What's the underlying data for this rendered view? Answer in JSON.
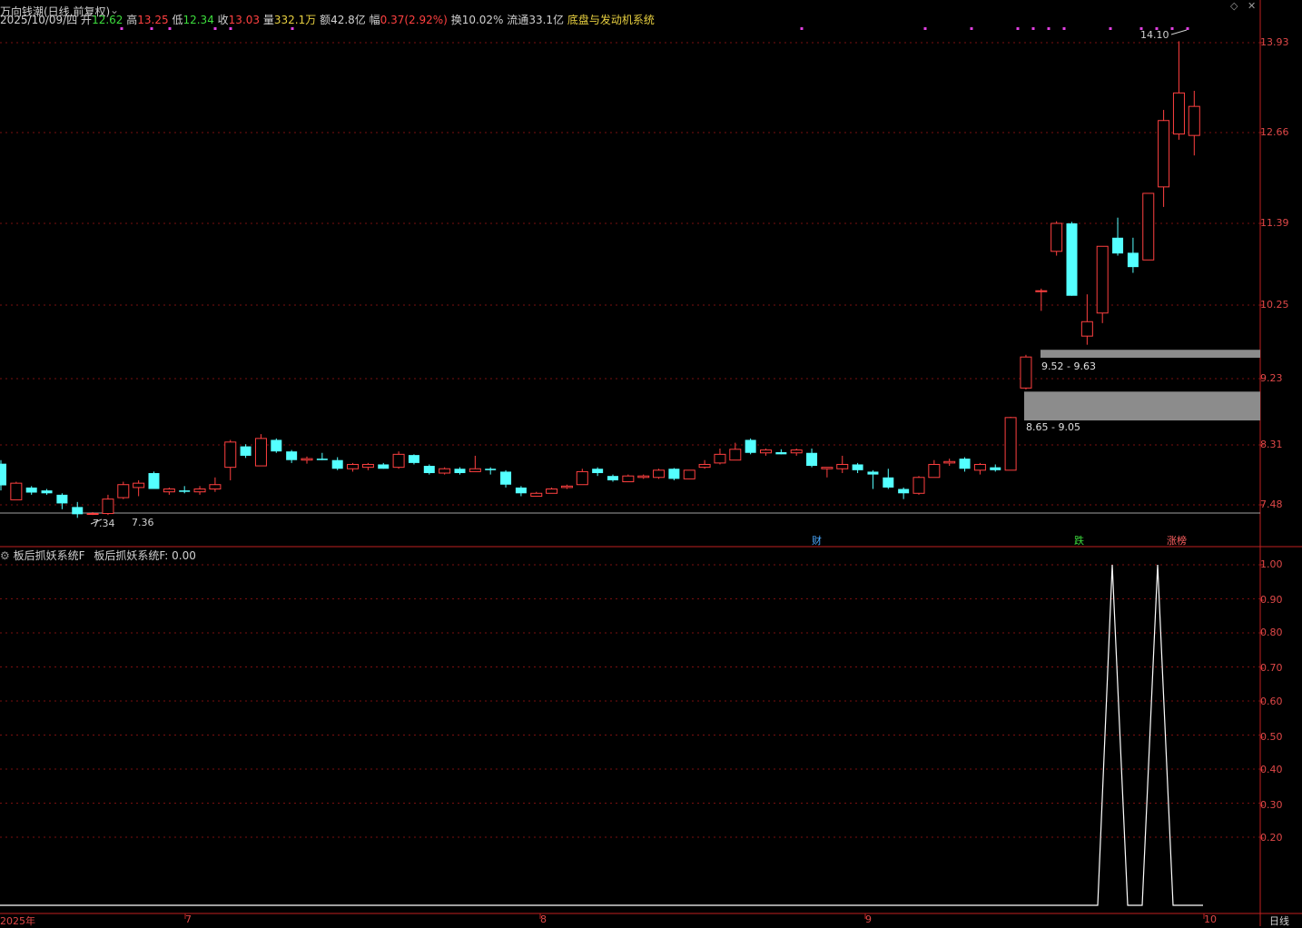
{
  "header": {
    "app_title": "万向钱潮(日线,前复权)",
    "date": "2025/10/09/四",
    "open_label": "开",
    "open": "12.62",
    "high_label": "高",
    "high": "13.25",
    "low_label": "低",
    "low": "12.34",
    "close_label": "收",
    "close": "13.03",
    "volume_label": "量",
    "volume": "332.1万",
    "amount_label": "额",
    "amount": "42.8亿",
    "change_label": "幅",
    "change": "0.37(2.92%)",
    "turnover_label": "换",
    "turnover": "10.02%",
    "float_label": "流通",
    "float": "33.1亿",
    "system_name": "底盘与发动机系统"
  },
  "price_axis": [
    "13.93",
    "12.66",
    "11.39",
    "10.25",
    "9.23",
    "8.31",
    "7.48"
  ],
  "indicator_axis": [
    "1.00",
    "0.90",
    "0.80",
    "0.70",
    "0.60",
    "0.50",
    "0.40",
    "0.30",
    "0.20"
  ],
  "x_axis": [
    "2025年",
    "7",
    "8",
    "9",
    "10"
  ],
  "period_label": "日线",
  "annotations": {
    "high_marker": "14.10",
    "low_marker_left": "7.34",
    "low_marker_right": "7.36",
    "gap_upper": "9.52 - 9.63",
    "gap_lower": "8.65 - 9.05"
  },
  "event_marks": [
    {
      "label": "财",
      "color": "#4aa8ff"
    },
    {
      "label": "跌",
      "color": "#3cdc3c"
    },
    {
      "label": "涨榜",
      "color": "#ff6060"
    }
  ],
  "indicator": {
    "name": "板后抓妖系统F",
    "value_text": "板后抓妖系统F: 0.00"
  },
  "colors": {
    "up": "#ff4040",
    "down": "#54ffff",
    "grid": "#7a1010",
    "axis": "#c02020"
  },
  "chart_data": [
    {
      "type": "candlestick",
      "title": "",
      "ylim": [
        7.2,
        14.2
      ],
      "series": [
        {
          "name": "",
          "ohlc": [
            [
              8.05,
              8.1,
              7.68,
              7.75
            ],
            [
              7.55,
              7.8,
              7.55,
              7.78
            ],
            [
              7.72,
              7.74,
              7.62,
              7.65
            ],
            [
              7.68,
              7.7,
              7.62,
              7.64
            ],
            [
              7.62,
              7.64,
              7.42,
              7.5
            ],
            [
              7.45,
              7.52,
              7.3,
              7.35
            ],
            [
              7.36,
              7.38,
              7.34,
              7.36
            ],
            [
              7.36,
              7.62,
              7.34,
              7.56
            ],
            [
              7.58,
              7.8,
              7.56,
              7.76
            ],
            [
              7.72,
              7.82,
              7.6,
              7.78
            ],
            [
              7.92,
              7.94,
              7.7,
              7.7
            ],
            [
              7.66,
              7.72,
              7.62,
              7.7
            ],
            [
              7.68,
              7.74,
              7.64,
              7.66
            ],
            [
              7.66,
              7.74,
              7.62,
              7.7
            ],
            [
              7.7,
              7.86,
              7.66,
              7.76
            ],
            [
              8.0,
              8.38,
              7.82,
              8.35
            ],
            [
              8.29,
              8.32,
              8.13,
              8.16
            ],
            [
              8.02,
              8.46,
              8.02,
              8.4
            ],
            [
              8.38,
              8.4,
              8.2,
              8.22
            ],
            [
              8.22,
              8.24,
              8.06,
              8.1
            ],
            [
              8.1,
              8.15,
              8.05,
              8.12
            ],
            [
              8.12,
              8.2,
              8.1,
              8.1
            ],
            [
              8.1,
              8.14,
              7.96,
              7.98
            ],
            [
              7.98,
              8.06,
              7.94,
              8.04
            ],
            [
              8.0,
              8.06,
              7.96,
              8.04
            ],
            [
              8.04,
              8.06,
              7.98,
              7.98
            ],
            [
              8.0,
              8.22,
              7.98,
              8.18
            ],
            [
              8.17,
              8.18,
              8.04,
              8.06
            ],
            [
              8.02,
              8.04,
              7.9,
              7.92
            ],
            [
              7.92,
              8.0,
              7.9,
              7.98
            ],
            [
              7.98,
              8.0,
              7.9,
              7.92
            ],
            [
              7.94,
              8.16,
              7.94,
              7.98
            ],
            [
              7.98,
              8.0,
              7.9,
              7.96
            ],
            [
              7.94,
              7.96,
              7.72,
              7.76
            ],
            [
              7.72,
              7.74,
              7.6,
              7.64
            ],
            [
              7.6,
              7.66,
              7.6,
              7.64
            ],
            [
              7.64,
              7.72,
              7.64,
              7.7
            ],
            [
              7.72,
              7.76,
              7.7,
              7.74
            ],
            [
              7.76,
              7.98,
              7.76,
              7.94
            ],
            [
              7.98,
              8.0,
              7.88,
              7.92
            ],
            [
              7.88,
              7.9,
              7.8,
              7.82
            ],
            [
              7.8,
              7.9,
              7.8,
              7.88
            ],
            [
              7.86,
              7.9,
              7.84,
              7.88
            ],
            [
              7.86,
              7.98,
              7.84,
              7.96
            ],
            [
              7.98,
              7.99,
              7.82,
              7.84
            ],
            [
              7.84,
              7.96,
              7.84,
              7.96
            ],
            [
              8.0,
              8.1,
              7.98,
              8.04
            ],
            [
              8.06,
              8.26,
              8.04,
              8.18
            ],
            [
              8.1,
              8.34,
              8.1,
              8.25
            ],
            [
              8.38,
              8.4,
              8.18,
              8.2
            ],
            [
              8.2,
              8.26,
              8.16,
              8.24
            ],
            [
              8.21,
              8.25,
              8.18,
              8.18
            ],
            [
              8.2,
              8.26,
              8.16,
              8.24
            ],
            [
              8.2,
              8.26,
              8.0,
              8.02
            ],
            [
              7.98,
              8.0,
              7.86,
              8.0
            ],
            [
              7.98,
              8.16,
              7.92,
              8.04
            ],
            [
              8.04,
              8.06,
              7.92,
              7.96
            ],
            [
              7.94,
              7.96,
              7.7,
              7.9
            ],
            [
              7.86,
              7.98,
              7.7,
              7.72
            ],
            [
              7.7,
              7.72,
              7.56,
              7.64
            ],
            [
              7.64,
              7.88,
              7.62,
              7.86
            ],
            [
              7.86,
              8.1,
              7.86,
              8.04
            ],
            [
              8.06,
              8.12,
              8.02,
              8.08
            ],
            [
              8.12,
              8.14,
              7.94,
              7.98
            ],
            [
              7.96,
              8.06,
              7.9,
              8.04
            ],
            [
              8.0,
              8.04,
              7.94,
              7.96
            ],
            [
              7.96,
              8.7,
              7.96,
              8.69
            ],
            [
              9.1,
              9.56,
              9.08,
              9.53
            ],
            [
              10.45,
              10.48,
              10.17,
              10.45
            ],
            [
              11.0,
              11.42,
              10.94,
              11.39
            ],
            [
              11.39,
              11.41,
              10.38,
              10.38
            ],
            [
              9.82,
              10.4,
              9.7,
              10.02
            ],
            [
              10.14,
              11.07,
              10.0,
              11.07
            ],
            [
              11.19,
              11.47,
              10.94,
              10.97
            ],
            [
              10.98,
              11.19,
              10.7,
              10.78
            ],
            [
              10.88,
              11.81,
              10.88,
              11.81
            ],
            [
              11.9,
              12.98,
              11.62,
              12.83
            ],
            [
              12.64,
              13.95,
              12.56,
              13.22
            ],
            [
              12.62,
              13.25,
              12.34,
              13.03
            ]
          ]
        }
      ]
    },
    {
      "type": "line",
      "title": "",
      "ylim": [
        0,
        1.05
      ],
      "x": [
        1209,
        1225,
        1242,
        1258,
        1275,
        1292
      ],
      "series": [
        {
          "name": "板后抓妖系统F",
          "values": [
            0,
            1,
            0,
            0,
            1,
            0
          ]
        }
      ]
    }
  ]
}
